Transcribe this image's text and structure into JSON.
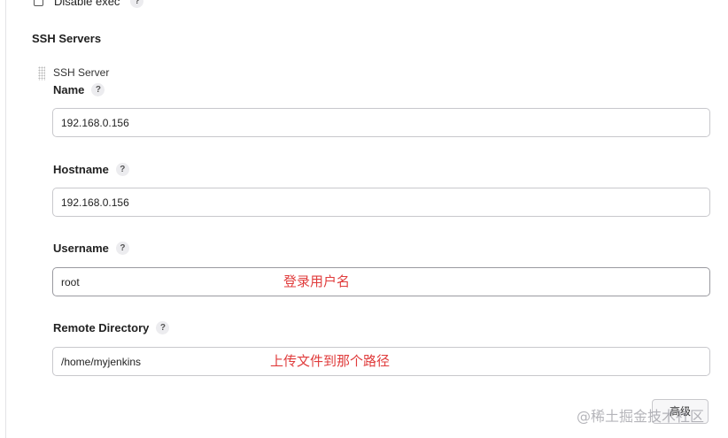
{
  "top": {
    "checkbox_label": "Disable exec",
    "help": "?"
  },
  "ssh": {
    "section_title": "SSH Servers",
    "server_label": "SSH Server",
    "help": "?",
    "fields": {
      "name": {
        "label": "Name",
        "value": "192.168.0.156"
      },
      "hostname": {
        "label": "Hostname",
        "value": "192.168.0.156"
      },
      "username": {
        "label": "Username",
        "value": "root",
        "annotation": "登录用户名"
      },
      "remote_directory": {
        "label": "Remote Directory",
        "value": "/home/myjenkins",
        "annotation": "上传文件到那个路径"
      }
    },
    "button_label": "高级"
  },
  "watermark": "@稀土掘金技术社区"
}
